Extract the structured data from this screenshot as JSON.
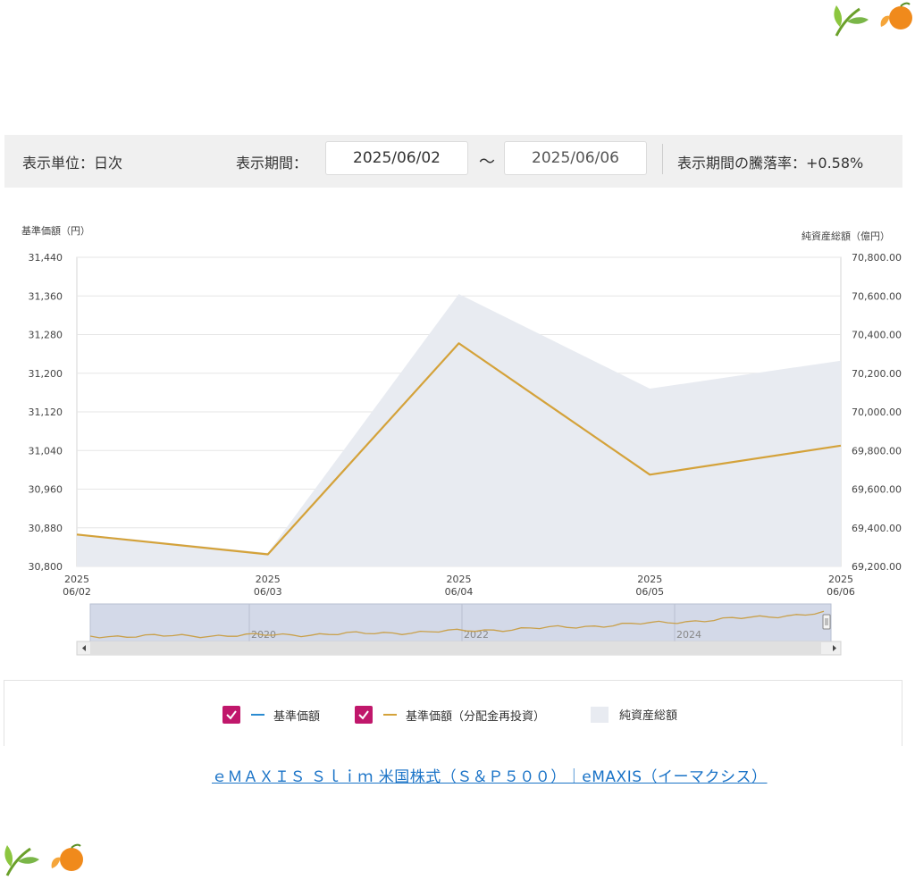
{
  "controls": {
    "unit_label": "表示単位：日次",
    "period_label": "表示期間：",
    "date_from": "2025/06/02",
    "tilde": "～",
    "date_to": "2025/06/06",
    "change_label": "表示期間の騰落率：+0.58%"
  },
  "chart_data": {
    "type": "line",
    "ylabel_left": "基準価額（円）",
    "ylabel_right": "純資産総額（億円）",
    "x": [
      "2025\n06/02",
      "2025\n06/03",
      "2025\n06/04",
      "2025\n06/05",
      "2025\n06/06"
    ],
    "yticks_left": [
      "31,440",
      "31,360",
      "31,280",
      "31,200",
      "31,120",
      "31,040",
      "30,960",
      "30,880",
      "30,800"
    ],
    "yticks_right": [
      "70,800.00",
      "70,600.00",
      "70,400.00",
      "70,200.00",
      "70,000.00",
      "69,800.00",
      "69,600.00",
      "69,400.00",
      "69,200.00"
    ],
    "ylim_left": [
      30800,
      31440
    ],
    "ylim_right": [
      69200,
      70800
    ],
    "series": [
      {
        "name": "基準価額（分配金再投資）",
        "axis": "left",
        "style": "line",
        "color": "#d4a23a",
        "values": [
          30866,
          30825,
          31262,
          30990,
          31050
        ]
      },
      {
        "name": "純資産総額",
        "axis": "right",
        "style": "area",
        "color": "#e8ebf1",
        "values": [
          69370,
          69270,
          70610,
          70120,
          70265
        ]
      }
    ],
    "navigator": {
      "labels": [
        "2020",
        "2022",
        "2024"
      ]
    },
    "grid": true
  },
  "legend": {
    "item1": "基準価額",
    "item2": "基準価額（分配金再投資）",
    "item3": "純資産総額",
    "color1": "#2a8bd1",
    "color2": "#d4a23a",
    "check_color": "#c0176b"
  },
  "source_link": "ｅＭＡＸＩＳ Ｓｌｉｍ 米国株式（Ｓ＆Ｐ５００）｜eMAXIS（イーマクシス）"
}
